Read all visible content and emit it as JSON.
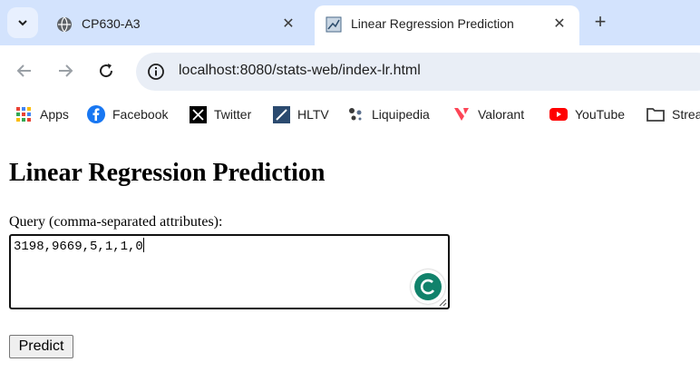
{
  "tabs": [
    {
      "title": "CP630-A3",
      "active": false
    },
    {
      "title": "Linear Regression Prediction",
      "active": true
    }
  ],
  "toolbar": {
    "url": "localhost:8080/stats-web/index-lr.html"
  },
  "bookmarks": [
    {
      "label": "Apps",
      "icon": "apps-grid-icon"
    },
    {
      "label": "Facebook",
      "icon": "facebook-icon"
    },
    {
      "label": "Twitter",
      "icon": "x-twitter-icon"
    },
    {
      "label": "HLTV",
      "icon": "hltv-icon"
    },
    {
      "label": "Liquipedia",
      "icon": "liquipedia-icon"
    },
    {
      "label": "Valorant",
      "icon": "valorant-icon"
    },
    {
      "label": "YouTube",
      "icon": "youtube-icon"
    },
    {
      "label": "Strea",
      "icon": "folder-icon"
    }
  ],
  "page": {
    "heading": "Linear Regression Prediction",
    "query_label": "Query (comma-separated attributes):",
    "query_value": "3198,9669,5,1,1,0",
    "predict_label": "Predict"
  },
  "colors": {
    "tabstrip": "#d3e3fd",
    "omnibox": "#e9eef6",
    "grammarly": "#15c39a"
  }
}
